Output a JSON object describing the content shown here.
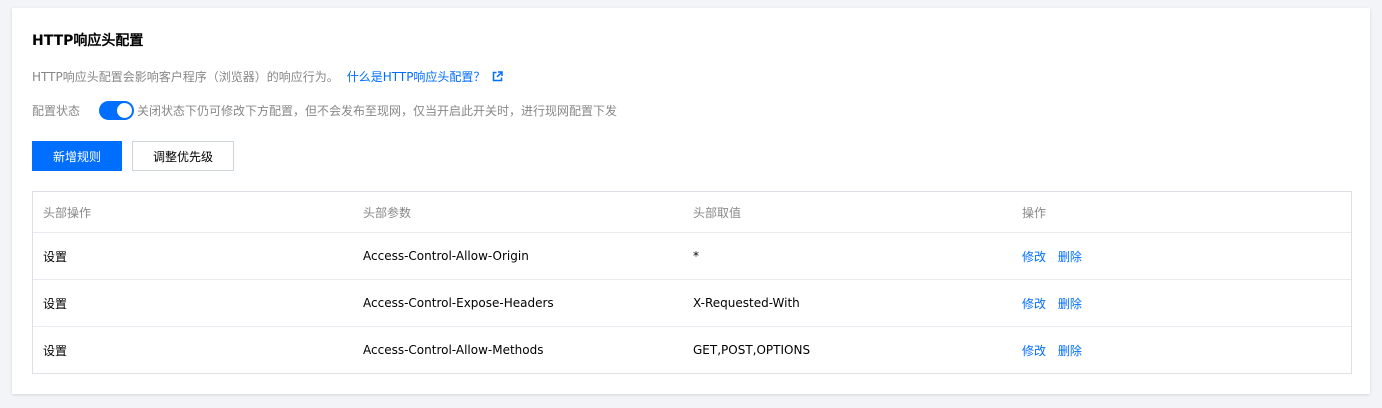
{
  "page": {
    "title": "HTTP响应头配置",
    "description": "HTTP响应头配置会影响客户程序（浏览器）的响应行为。",
    "help_link": "什么是HTTP响应头配置？",
    "external_icon": "external-link-icon"
  },
  "config_status": {
    "label": "配置状态",
    "enabled": true,
    "hint": "关闭状态下仍可修改下方配置，但不会发布至现网，仅当开启此开关时，进行现网配置下发"
  },
  "toolbar": {
    "add_label": "新增规则",
    "priority_label": "调整优先级"
  },
  "table": {
    "headers": [
      "头部操作",
      "头部参数",
      "头部取值",
      "操作"
    ],
    "rows": [
      {
        "op": "设置",
        "param": "Access-Control-Allow-Origin",
        "value": "*",
        "edit": "修改",
        "delete": "删除"
      },
      {
        "op": "设置",
        "param": "Access-Control-Expose-Headers",
        "value": "X-Requested-With",
        "edit": "修改",
        "delete": "删除"
      },
      {
        "op": "设置",
        "param": "Access-Control-Allow-Methods",
        "value": "GET,POST,OPTIONS",
        "edit": "修改",
        "delete": "删除"
      }
    ]
  },
  "colors": {
    "accent": "#006eff",
    "muted_text": "#888888",
    "background": "#f2f4f7"
  }
}
